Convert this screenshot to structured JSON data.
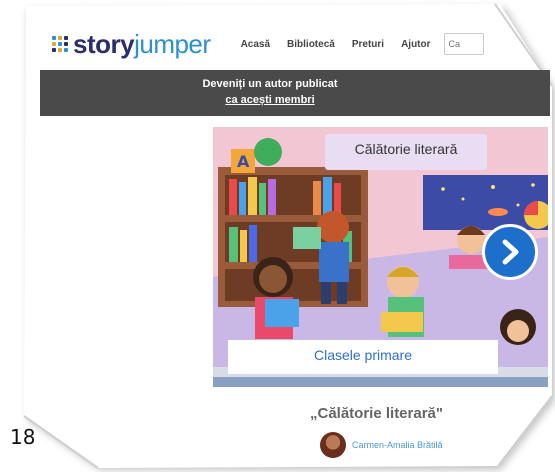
{
  "page_number": "18",
  "header": {
    "logo_bold": "story",
    "logo_light": "jumper",
    "nav": [
      {
        "label": "Acasă"
      },
      {
        "label": "Bibliotecă"
      },
      {
        "label": "Preturi"
      },
      {
        "label": "Ajutor"
      }
    ],
    "search_placeholder": "Ca"
  },
  "banner": {
    "line1": "Deveniți un autor publicat",
    "line2": "ca acești membri"
  },
  "book": {
    "title": "Călătorie literară",
    "subtitle": "Clasele primare",
    "next_icon": "chevron-right-icon"
  },
  "caption": "„Călătorie literară\"",
  "author": {
    "name": "Carmen-Amalia Brătilă"
  },
  "colors": {
    "banner_bg": "#4a4a4a",
    "logo_dark": "#2a2f6b",
    "logo_light": "#2c8fcf",
    "accent_blue": "#1d6fcc",
    "title_box": "#e8ddf2"
  }
}
